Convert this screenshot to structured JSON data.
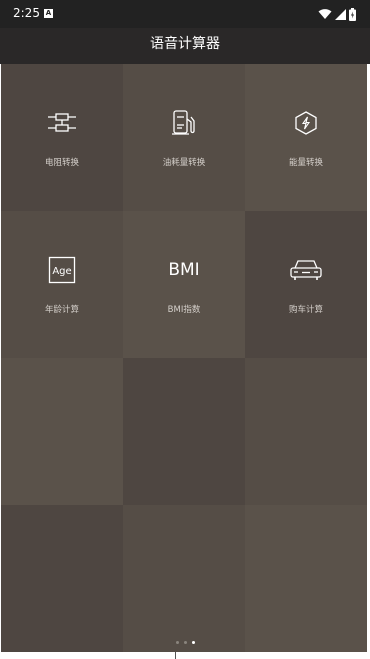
{
  "status_bar": {
    "time": "2:25",
    "notification_letter": "A",
    "icons": [
      "wifi-icon",
      "signal-icon",
      "battery-icon"
    ]
  },
  "app": {
    "title": "语音计算器"
  },
  "tiles": [
    {
      "label": "电阻转换",
      "icon": "resistor-icon",
      "color": "#4e4641"
    },
    {
      "label": "油耗量转换",
      "icon": "fuel-pump-icon",
      "color": "#554d46"
    },
    {
      "label": "能量转换",
      "icon": "energy-icon",
      "color": "#5a524a"
    },
    {
      "label": "年龄计算",
      "icon": "age-icon",
      "icon_text": "Age",
      "color": "#554d46"
    },
    {
      "label": "BMI指数",
      "icon": "bmi-icon",
      "icon_text": "BMI",
      "color": "#5a524a"
    },
    {
      "label": "购车计算",
      "icon": "car-icon",
      "color": "#4e4641"
    },
    {
      "label": "",
      "color": "#5a524a"
    },
    {
      "label": "",
      "color": "#4e4641"
    },
    {
      "label": "",
      "color": "#554d46"
    },
    {
      "label": "",
      "color": "#4e4641"
    },
    {
      "label": "",
      "color": "#554d46"
    },
    {
      "label": "",
      "color": "#5a524a"
    }
  ],
  "pager": {
    "total": 3,
    "active": 3
  }
}
